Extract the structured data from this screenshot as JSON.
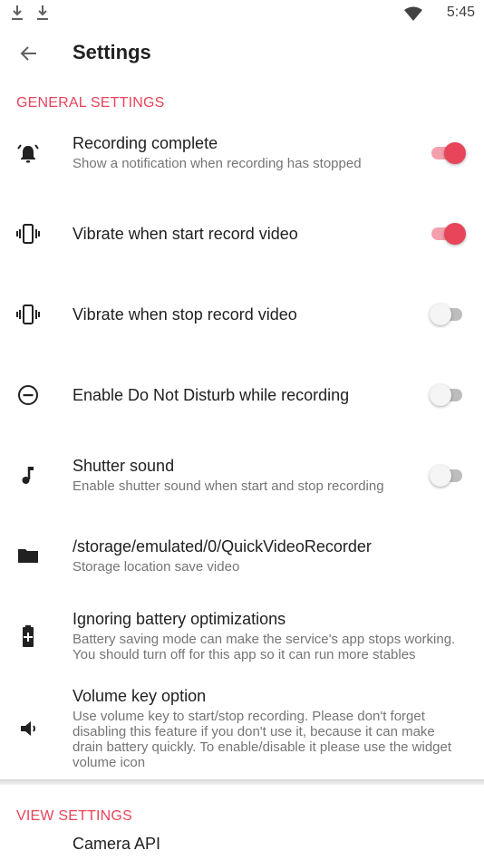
{
  "status_bar": {
    "time": "5:45"
  },
  "app_bar": {
    "title": "Settings"
  },
  "general_settings": {
    "header": "GENERAL SETTINGS",
    "items": [
      {
        "title": "Recording complete",
        "subtitle": "Show a notification when recording has stopped",
        "icon": "alarm-bell-icon",
        "switch": true
      },
      {
        "title": "Vibrate when start record video",
        "icon": "vibrate-icon",
        "switch": true
      },
      {
        "title": "Vibrate when stop record video",
        "icon": "vibrate-icon",
        "switch": false
      },
      {
        "title": "Enable Do Not Disturb while recording",
        "icon": "do-not-disturb-icon",
        "switch": false
      },
      {
        "title": "Shutter sound",
        "subtitle": "Enable shutter sound when start and stop recording",
        "icon": "music-note-icon",
        "switch": false
      },
      {
        "title": "/storage/emulated/0/QuickVideoRecorder",
        "subtitle": "Storage location save video",
        "icon": "folder-icon"
      },
      {
        "title": "Ignoring battery optimizations",
        "subtitle": "Battery saving mode can make the service's app stops working. You should turn off for this app so it can run more stables",
        "icon": "battery-plus-icon"
      },
      {
        "title": "Volume key option",
        "subtitle": "Use volume key to start/stop recording. Please don't forget disabling this feature if you don't use it, because it can make drain battery quickly. To enable/disable it please use the widget volume icon",
        "icon": "volume-icon"
      }
    ]
  },
  "view_settings": {
    "header": "VIEW SETTINGS",
    "items": [
      {
        "title": "Camera API"
      }
    ]
  },
  "colors": {
    "accent": "#e8445a",
    "accent_light": "#f4a0ac"
  }
}
